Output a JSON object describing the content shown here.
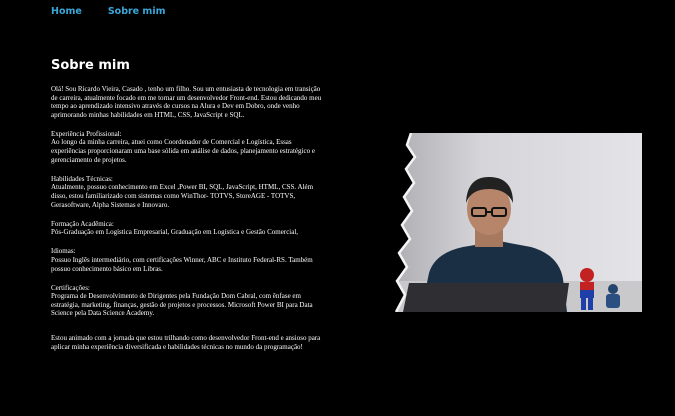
{
  "nav": {
    "home": "Home",
    "about": "Sobre mim"
  },
  "page_title": "Sobre mim",
  "intro": "Olá! Sou Ricardo Vieira, Casado , tenho um filho. Sou um entusiasta de tecnologia em transição de carreira, atualmente focado em me tornar um desenvolvedor Front-end. Estou dedicando meu tempo ao aprendizado intensivo através de cursos na Alura e Dev em Dobro, onde venho aprimorando minhas habilidades em HTML, CSS, JavaScript e SQL.",
  "sections": [
    {
      "heading": "Experiência Profissional:",
      "body": "Ao longo da minha carreira, atuei como Coordenador de Comercial e Logística, Essas experiências proporcionaram uma base sólida em análise de dados, planejamento estratégico e gerenciamento de projetos."
    },
    {
      "heading": "Habilidades Técnicas:",
      "body": "Atualmente, possuo conhecimento em Excel ,Power BI, SQL, JavaScript, HTML, CSS. Além disso, estou familiarizado com sistemas como WinThor- TOTVS, StoreAGE - TOTVS, Gerasoftware, Alpha Sistemas e Innovaro."
    },
    {
      "heading": "Formação Acadêmica:",
      "body": "Pós-Graduação em Logística Empresarial, Graduação em Logística e Gestão Comercial,"
    },
    {
      "heading": "Idiomas:",
      "body": "Possuo Inglês intermediário, com certificações Winner, ABC e Instituto Federal-RS. Também possuo conhecimento básico em Libras."
    },
    {
      "heading": "Certificações:",
      "body": "Programa de Desenvolvimento de Dirigentes pela Fundação Dom Cabral, com ênfase em estratégia, marketing, finanças, gestão de projetos e processos. Microsoft Power BI para Data Science pela Data Science Academy."
    }
  ],
  "closing": "Estou animado com a jornada que estou trilhando como desenvolvedor Front-end e ansioso para aplicar minha experiência diversificada e habilidades técnicas no mundo da programação!"
}
